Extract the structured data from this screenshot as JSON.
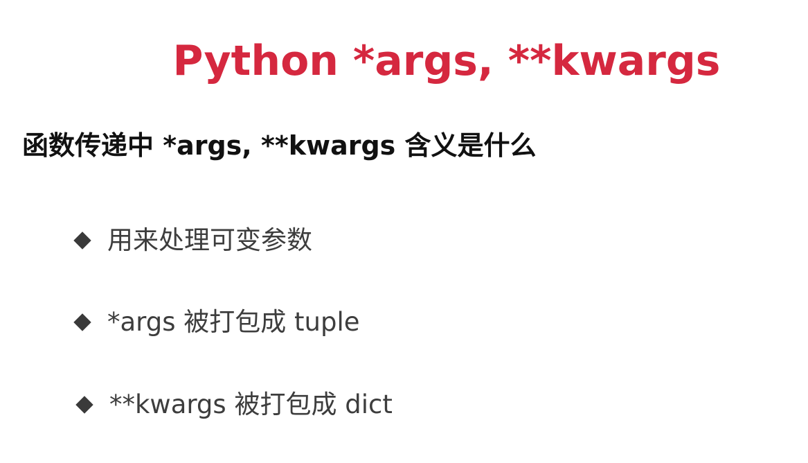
{
  "slide": {
    "title": "Python *args, **kwargs",
    "subtitle": "函数传递中 *args, **kwargs 含义是什么",
    "bullets": [
      {
        "icon": "diamond-bullet-icon",
        "text": "用来处理可变参数"
      },
      {
        "icon": "diamond-bullet-icon",
        "text": "*args 被打包成 tuple"
      },
      {
        "icon": "diamond-bullet-icon",
        "text": "**kwargs 被打包成 dict"
      }
    ],
    "colors": {
      "title": "#d5283f",
      "subtitle": "#111111",
      "bullet_text": "#3d3d3d",
      "bullet_icon": "#3a3a3a",
      "background": "#ffffff"
    }
  }
}
